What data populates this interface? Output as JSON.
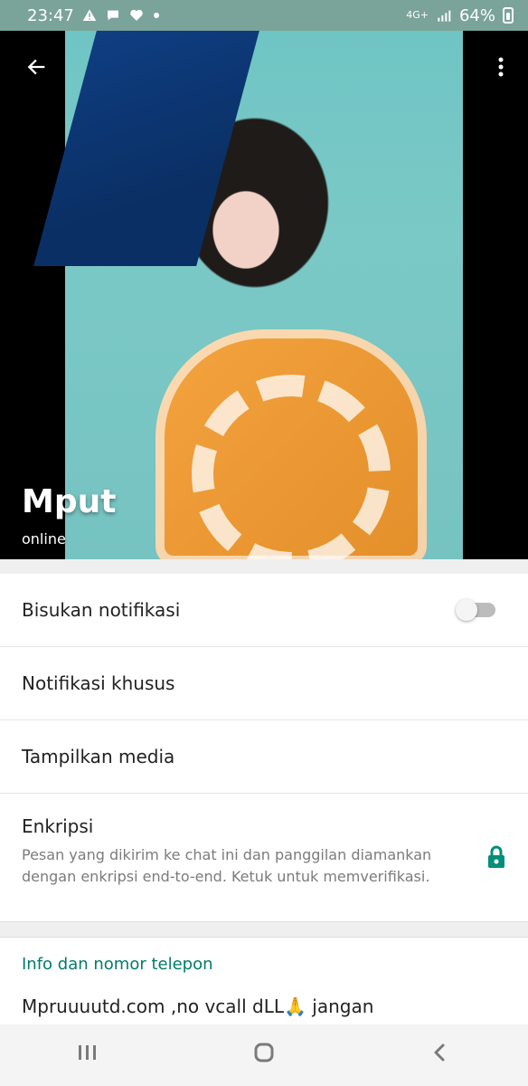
{
  "status_bar": {
    "time": "23:47",
    "icons_left": [
      "warning-icon",
      "chat-icon",
      "heart-icon",
      "dot-icon"
    ],
    "network": "4G+",
    "battery": "64%"
  },
  "profile": {
    "name": "Mput",
    "status": "online"
  },
  "settings": {
    "mute_label": "Bisukan notifikasi",
    "custom_notifications_label": "Notifikasi khusus",
    "media_label": "Tampilkan media",
    "encryption_label": "Enkripsi",
    "encryption_desc": "Pesan yang dikirim ke chat ini dan panggilan diamankan dengan enkripsi end-to-end. Ketuk untuk memverifikasi."
  },
  "info": {
    "header": "Info dan nomor telepon",
    "about": "Mpruuuutd.com ,no vcall dLL🙏 jangan"
  },
  "colors": {
    "status_bar": "#7aa39a",
    "accent": "#007b6c",
    "lock": "#008f7a"
  }
}
